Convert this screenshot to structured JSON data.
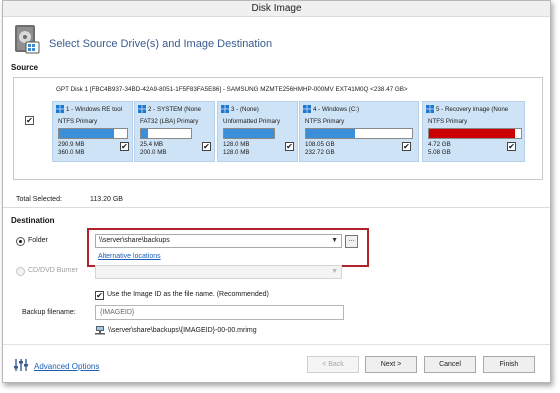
{
  "window": {
    "title": "Disk Image"
  },
  "header": {
    "title": "Select Source Drive(s) and Image Destination",
    "icon": "disk-image-icon"
  },
  "source": {
    "label": "Source",
    "disk_selected": true,
    "disk_info": "GPT Disk 1 [FBC4B937-34BD-42A9-8051-1F5F83FA5E86] - SAMSUNG MZMTE256HMHP-000MV EXT41M0Q  <238.47 GB>",
    "partitions": [
      {
        "name": "1 - Windows RE tool",
        "fs": "NTFS Primary",
        "used": "290.9 MB",
        "total": "360.0 MB",
        "fill": 0.81,
        "fill_color": "#3b8fd9",
        "checked": true
      },
      {
        "name": "2 - SYSTEM (None",
        "fs": "FAT32 (LBA) Primary",
        "used": "25.4 MB",
        "total": "200.0 MB",
        "fill": 0.13,
        "fill_color": "#3b8fd9",
        "checked": true
      },
      {
        "name": "3 - (None)",
        "fs": "Unformatted Primary",
        "used": "128.0 MB",
        "total": "128.0 MB",
        "fill": 1.0,
        "fill_color": "#3b8fd9",
        "checked": true
      },
      {
        "name": "4 - Windows (C:)",
        "fs": "NTFS Primary",
        "used": "108.05 GB",
        "total": "232.72 GB",
        "fill": 0.46,
        "fill_color": "#3b8fd9",
        "checked": true
      },
      {
        "name": "5 - Recovery image (None",
        "fs": "NTFS Primary",
        "used": "4.72 GB",
        "total": "5.08 GB",
        "fill": 0.93,
        "fill_color": "#cc0000",
        "checked": true
      }
    ],
    "total_label": "Total Selected:",
    "total_value": "113.20 GB"
  },
  "destination": {
    "label": "Destination",
    "folder_label": "Folder",
    "folder_selected": true,
    "folder_path": "\\\\server\\share\\backups",
    "browse_label": "...",
    "alt_link": "Alternative locations",
    "cd_label": "CD/DVD Burner",
    "cd_value": ""
  },
  "backup": {
    "use_id_checked": true,
    "use_id_label": "Use the Image ID as the file name.  (Recommended)",
    "filename_label": "Backup filename:",
    "filename_placeholder": "{IMAGEID}",
    "path_preview": "\\\\server\\share\\backups\\{IMAGEID}-00-00.mrimg"
  },
  "footer": {
    "advanced_label": "Advanced Options",
    "back_label": "< Back",
    "next_label": "Next >",
    "cancel_label": "Cancel",
    "finish_label": "Finish"
  },
  "colors": {
    "accent": "#3a5c8f",
    "partition_bg": "#cfe3f6",
    "highlight": "#b0232a",
    "link": "#1e5fb4"
  }
}
